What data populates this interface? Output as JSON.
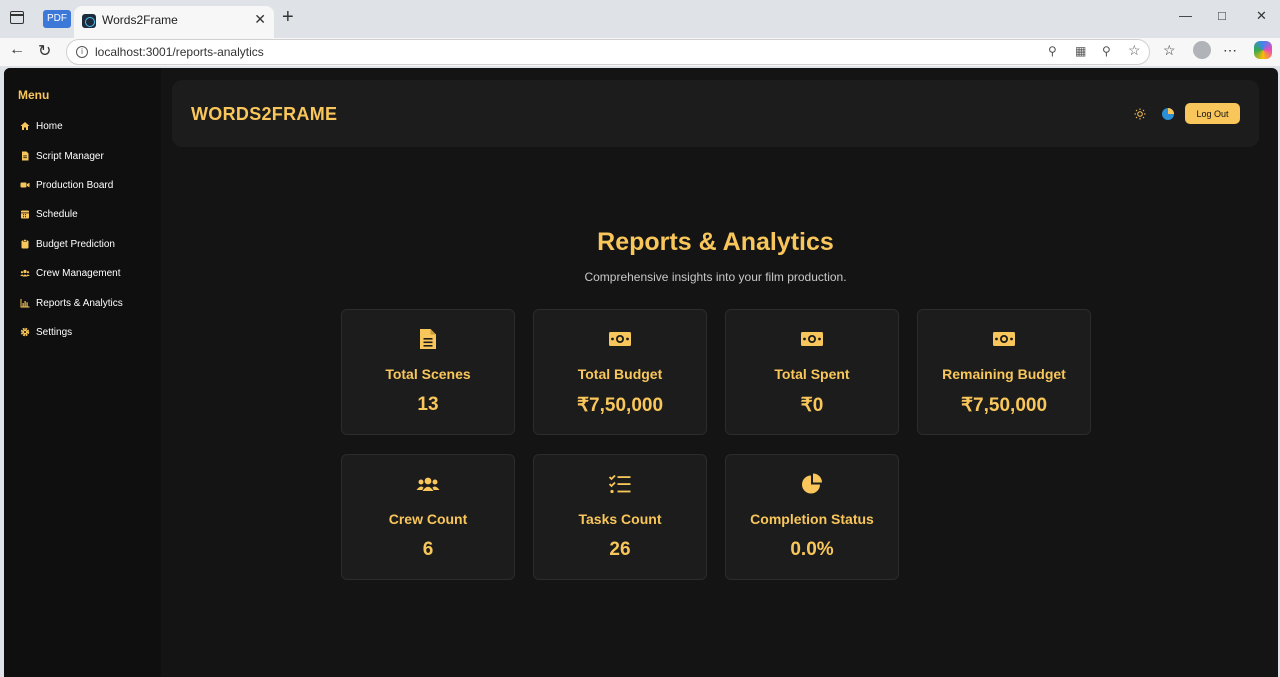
{
  "browser": {
    "pdf_tab": "PDF",
    "tab_title": "Words2Frame",
    "tab_close": "✕",
    "new_tab": "+",
    "url": "localhost:3001/reports-analytics"
  },
  "sidebar": {
    "title": "Menu",
    "items": [
      {
        "label": "Home",
        "icon": "home-icon"
      },
      {
        "label": "Script Manager",
        "icon": "file-icon"
      },
      {
        "label": "Production Board",
        "icon": "video-icon"
      },
      {
        "label": "Schedule",
        "icon": "calendar-icon"
      },
      {
        "label": "Budget Prediction",
        "icon": "clipboard-icon"
      },
      {
        "label": "Crew Management",
        "icon": "users-icon"
      },
      {
        "label": "Reports & Analytics",
        "icon": "chart-icon"
      },
      {
        "label": "Settings",
        "icon": "gear-icon"
      }
    ]
  },
  "header": {
    "brand": "WORDS2FRAME",
    "logout_label": "Log Out"
  },
  "main": {
    "title": "Reports & Analytics",
    "subtitle": "Comprehensive insights into your film production.",
    "cards": [
      {
        "label": "Total Scenes",
        "value": "13",
        "icon": "file-icon"
      },
      {
        "label": "Total Budget",
        "value": "₹7,50,000",
        "icon": "money-icon"
      },
      {
        "label": "Total Spent",
        "value": "₹0",
        "icon": "money-icon"
      },
      {
        "label": "Remaining Budget",
        "value": "₹7,50,000",
        "icon": "money-icon"
      },
      {
        "label": "Crew Count",
        "value": "6",
        "icon": "users-icon"
      },
      {
        "label": "Tasks Count",
        "value": "26",
        "icon": "tasks-icon"
      },
      {
        "label": "Completion Status",
        "value": "0.0%",
        "icon": "pie-chart-icon"
      }
    ]
  },
  "colors": {
    "accent": "#f8c65a",
    "background": "#141414",
    "sidebar": "#0f0f0f",
    "card": "#1c1c1c"
  }
}
